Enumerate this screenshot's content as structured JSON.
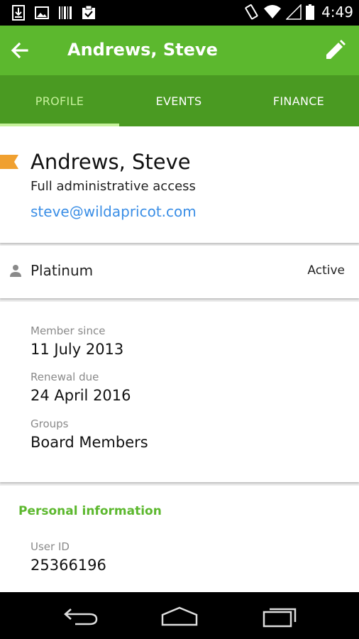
{
  "status_bar": {
    "time": "4:49",
    "left_icons": [
      "download-icon",
      "image-icon",
      "barcode-icon",
      "clipboard-check-icon"
    ],
    "right_icons": [
      "vibrate-icon",
      "wifi-icon",
      "signal-icon",
      "battery-icon"
    ]
  },
  "app_bar": {
    "title": "Andrews, Steve",
    "back_icon": "arrow-back-icon",
    "edit_icon": "pencil-icon",
    "color": "#5cb82e"
  },
  "tabs": {
    "items": [
      {
        "label": "PROFILE",
        "active": true
      },
      {
        "label": "EVENTS",
        "active": false
      },
      {
        "label": "FINANCE",
        "active": false
      }
    ],
    "active_color": "#c6f29b",
    "background": "#4a9a22"
  },
  "profile": {
    "name": "Andrews, Steve",
    "access": "Full administrative access",
    "email": "steve@wildapricot.com",
    "flag_color": "#f0a030",
    "link_color": "#3a8ee6"
  },
  "membership_level": {
    "icon": "person-icon",
    "name": "Platinum",
    "status": "Active"
  },
  "membership_details": {
    "member_since_label": "Member since",
    "member_since": "11 July 2013",
    "renewal_due_label": "Renewal due",
    "renewal_due": "24 April 2016",
    "groups_label": "Groups",
    "groups": "Board Members"
  },
  "personal_information": {
    "section_title": "Personal information",
    "user_id_label": "User ID",
    "user_id": "25366196"
  },
  "nav_bar": {
    "icons": [
      "back-nav-icon",
      "home-nav-icon",
      "recents-nav-icon"
    ]
  }
}
